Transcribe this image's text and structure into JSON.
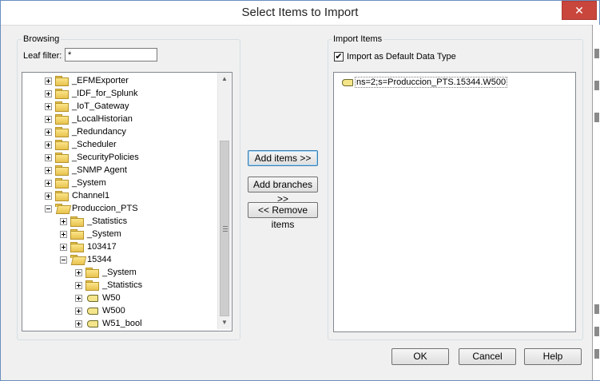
{
  "window": {
    "title": "Select Items to Import",
    "close_glyph": "✕"
  },
  "browsing": {
    "group_label": "Browsing",
    "leaf_filter_label": "Leaf filter:",
    "leaf_filter_value": "*",
    "tree": [
      {
        "label": "_EFMExporter",
        "icon": "folder-icon",
        "expander": "plus"
      },
      {
        "label": "_IDF_for_Splunk",
        "icon": "folder-icon",
        "expander": "plus"
      },
      {
        "label": "_IoT_Gateway",
        "icon": "folder-icon",
        "expander": "plus"
      },
      {
        "label": "_LocalHistorian",
        "icon": "folder-icon",
        "expander": "plus"
      },
      {
        "label": "_Redundancy",
        "icon": "folder-icon",
        "expander": "plus"
      },
      {
        "label": "_Scheduler",
        "icon": "folder-icon",
        "expander": "plus"
      },
      {
        "label": "_SecurityPolicies",
        "icon": "folder-icon",
        "expander": "plus"
      },
      {
        "label": "_SNMP Agent",
        "icon": "folder-icon",
        "expander": "plus"
      },
      {
        "label": "_System",
        "icon": "folder-icon",
        "expander": "plus"
      },
      {
        "label": "Channel1",
        "icon": "folder-icon",
        "expander": "plus"
      },
      {
        "label": "Produccion_PTS",
        "icon": "folder-open-icon",
        "expander": "minus"
      },
      {
        "label": "_Statistics",
        "icon": "folder-icon",
        "expander": "plus"
      },
      {
        "label": "_System",
        "icon": "folder-icon",
        "expander": "plus"
      },
      {
        "label": "103417",
        "icon": "folder-icon",
        "expander": "plus"
      },
      {
        "label": "15344",
        "icon": "folder-open-icon",
        "expander": "minus"
      },
      {
        "label": "_System",
        "icon": "folder-icon",
        "expander": "plus"
      },
      {
        "label": "_Statistics",
        "icon": "folder-icon",
        "expander": "plus"
      },
      {
        "label": "W50",
        "icon": "tag-icon",
        "expander": "plus"
      },
      {
        "label": "W500",
        "icon": "tag-icon",
        "expander": "plus"
      },
      {
        "label": "W51_bool",
        "icon": "tag-icon",
        "expander": "plus"
      }
    ]
  },
  "actions": {
    "add_items": "Add items >>",
    "add_branches": "Add branches >>",
    "remove_items": "<< Remove items"
  },
  "import": {
    "group_label": "Import Items",
    "default_type_label": "Import as Default Data Type",
    "default_type_checked": "✔",
    "items": [
      "ns=2;s=Produccion_PTS.15344.W500"
    ]
  },
  "footer": {
    "ok": "OK",
    "cancel": "Cancel",
    "help": "Help"
  }
}
